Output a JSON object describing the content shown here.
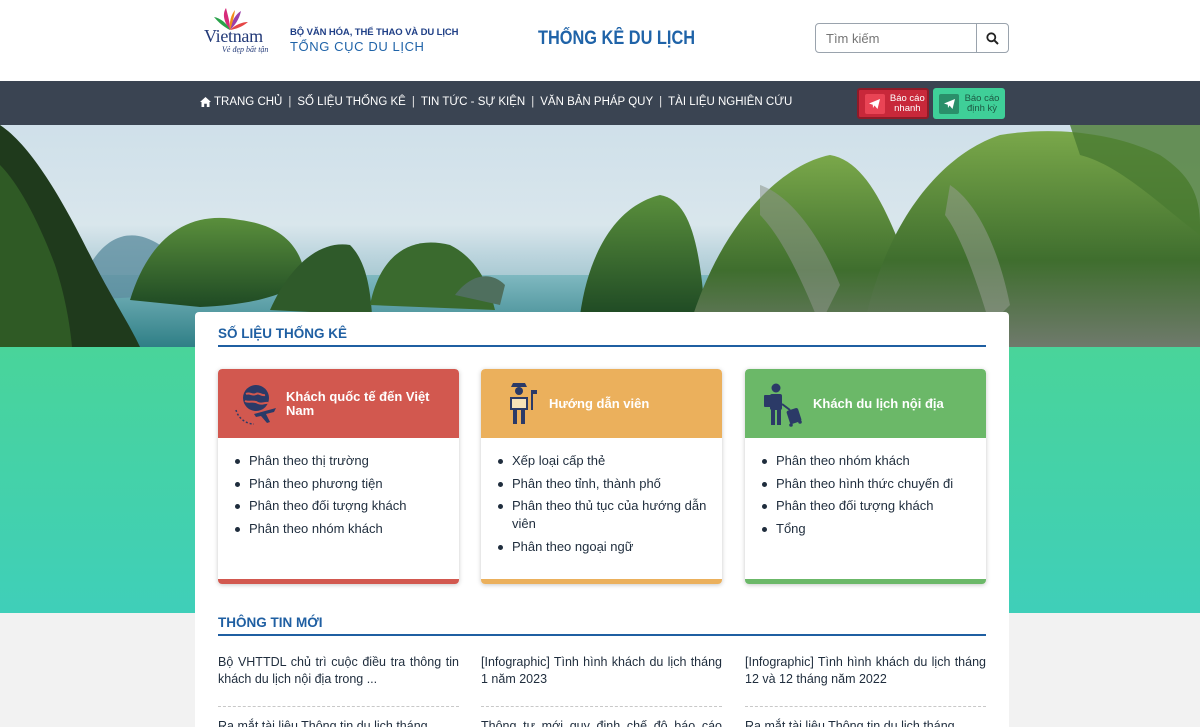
{
  "header": {
    "logo_brand": "Vietnam",
    "logo_tagline": "Vẻ đẹp bất tận",
    "ministry": "BỘ VĂN HÓA, THỂ THAO VÀ DU LỊCH",
    "agency": "TỔNG CỤC DU LỊCH",
    "site_title": "THỐNG KÊ DU LỊCH",
    "search_placeholder": "Tìm kiếm",
    "search_icon": "search-icon"
  },
  "nav": {
    "items": [
      {
        "label": "TRANG CHỦ",
        "icon": "home-icon"
      },
      {
        "label": "SỐ LIỆU THỐNG KÊ"
      },
      {
        "label": "TIN TỨC - SỰ KIỆN"
      },
      {
        "label": "VĂN BẢN PHÁP QUY"
      },
      {
        "label": "TÀI LIỆU NGHIÊN CỨU"
      }
    ],
    "quick_report": {
      "label": "Báo cáo nhanh",
      "icon": "send-icon",
      "color": "#c8283a"
    },
    "periodic_report": {
      "label": "Báo cáo định kỳ",
      "icon": "send-icon",
      "color": "#3fcf98"
    }
  },
  "stats": {
    "heading": "SỐ LIỆU THỐNG KÊ",
    "cards": [
      {
        "title": "Khách quốc tế đến Việt Nam",
        "icon": "globe-airplane-icon",
        "color": "#d2584f",
        "items": [
          "Phân theo thị trường",
          "Phân theo phương tiện",
          "Phân theo đối tượng khách",
          "Phân theo nhóm khách"
        ]
      },
      {
        "title": "Hướng dẫn viên",
        "icon": "tour-guide-icon",
        "color": "#ebb05c",
        "items": [
          "Xếp loại cấp thẻ",
          "Phân theo tỉnh, thành phố",
          "Phân theo thủ tục của hướng dẫn viên",
          "Phân theo ngoại ngữ"
        ]
      },
      {
        "title": "Khách du lịch nội địa",
        "icon": "traveler-luggage-icon",
        "color": "#6bb868",
        "items": [
          "Phân theo nhóm khách",
          "Phân theo hình thức chuyến đi",
          "Phân theo đối tượng khách",
          "Tổng"
        ]
      }
    ]
  },
  "news": {
    "heading": "THÔNG TIN MỚI",
    "columns": [
      [
        "Bộ VHTTDL chủ trì cuộc điều tra thông tin khách du lịch nội địa trong ...",
        "Ra mắt tài liệu Thông tin du lịch tháng"
      ],
      [
        "[Infographic] Tình hình khách du lịch tháng 1 năm 2023",
        "Thông tư mới quy định chế độ báo cáo thống"
      ],
      [
        "[Infographic] Tình hình khách du lịch tháng 12 và 12 tháng năm 2022",
        "Ra mắt tài liệu Thông tin du lịch tháng"
      ]
    ]
  }
}
